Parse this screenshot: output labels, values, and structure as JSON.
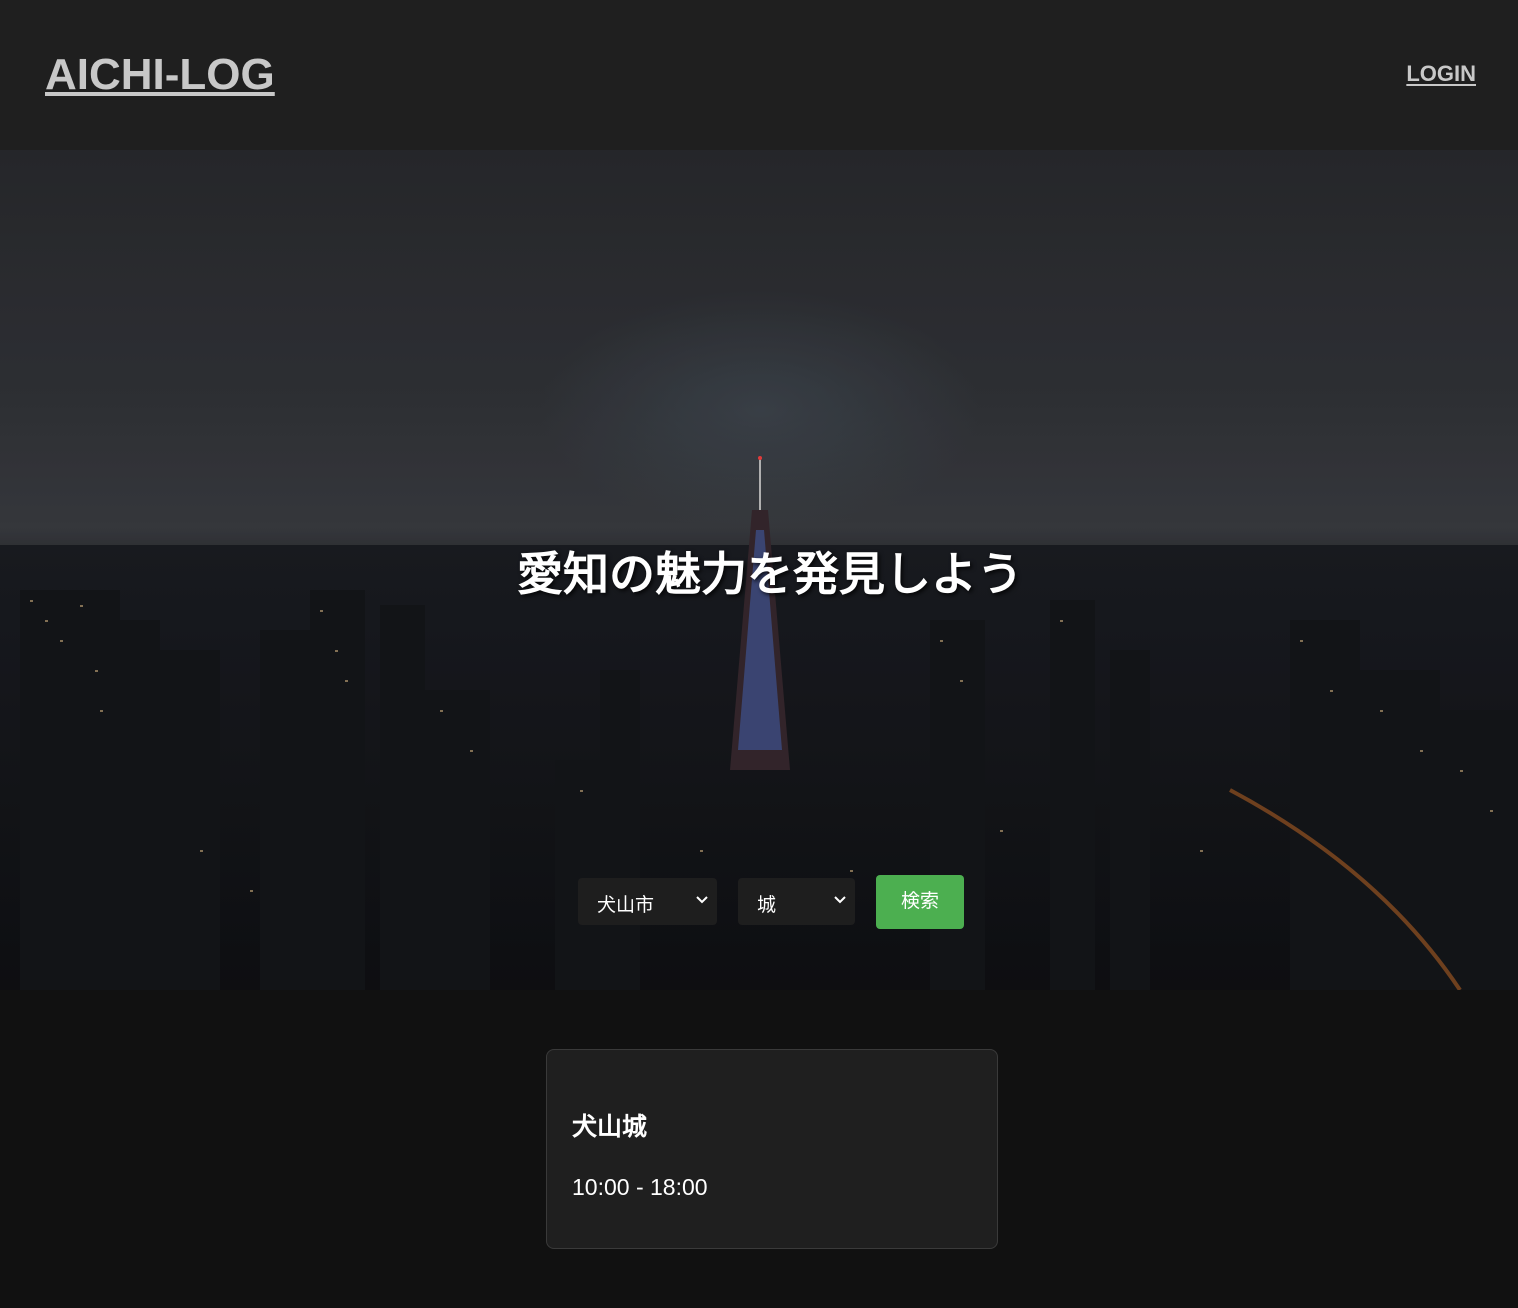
{
  "header": {
    "logo": "AICHI-LOG",
    "login_label": "LOGIN"
  },
  "hero": {
    "title": "愛知の魅力を発見しよう",
    "image_description": "night-city-skyline-photo"
  },
  "search": {
    "city_select": {
      "selected": "犬山市"
    },
    "category_select": {
      "selected": "城"
    },
    "button_label": "検索"
  },
  "results": [
    {
      "name": "犬山城",
      "hours": "10:00 - 18:00"
    }
  ],
  "colors": {
    "header_bg": "#1f1f1f",
    "page_bg": "#111111",
    "accent_button": "#4caf50",
    "card_bg": "#1f1f1f",
    "link_text": "#c8c8c8"
  }
}
